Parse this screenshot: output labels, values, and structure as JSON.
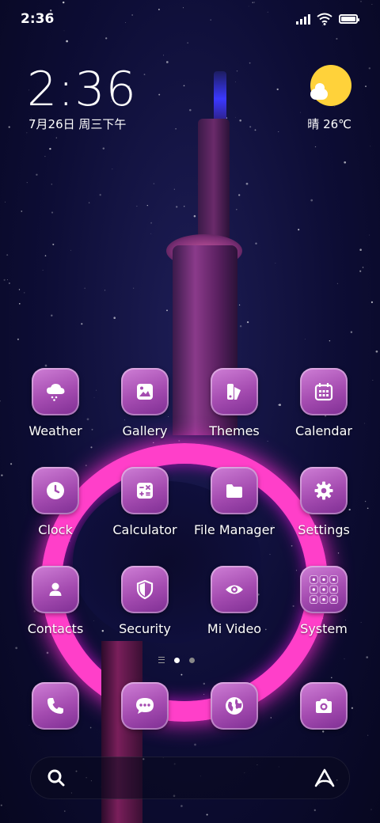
{
  "status_bar": {
    "time": "2:36"
  },
  "clock_widget": {
    "time": "2:36",
    "date": "7月26日 周三下午"
  },
  "weather_widget": {
    "text": "晴 26℃"
  },
  "apps": [
    {
      "label": "Weather"
    },
    {
      "label": "Gallery"
    },
    {
      "label": "Themes"
    },
    {
      "label": "Calendar"
    },
    {
      "label": "Clock"
    },
    {
      "label": "Calculator"
    },
    {
      "label": "File Manager"
    },
    {
      "label": "Settings"
    },
    {
      "label": "Contacts"
    },
    {
      "label": "Security"
    },
    {
      "label": "Mi Video"
    },
    {
      "label": "System"
    }
  ],
  "dock": [
    {
      "icon": "phone-icon"
    },
    {
      "icon": "messages-icon"
    },
    {
      "icon": "browser-icon"
    },
    {
      "icon": "camera-icon"
    }
  ],
  "page_indicator": {
    "pages": 2,
    "active": 1
  },
  "colors": {
    "icon_bg": "#a44bb0",
    "accent": "#ff3fc9",
    "sun": "#ffd23a"
  }
}
